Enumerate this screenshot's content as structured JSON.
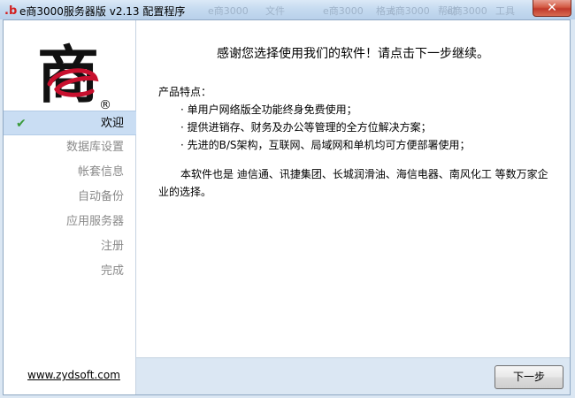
{
  "window": {
    "title": "e商3000服务器版 v2.13 配置程序",
    "close_label": "✕",
    "ghost_titles": [
      "e商3000",
      "文件",
      "e商3000",
      "格式",
      "e商3000",
      "帮助",
      "e商3000",
      "工具"
    ]
  },
  "logo": {
    "char": "商",
    "mark": "e",
    "registered": "®"
  },
  "sidebar": {
    "steps": [
      {
        "label": "欢迎",
        "active": true
      },
      {
        "label": "数据库设置",
        "active": false
      },
      {
        "label": "帐套信息",
        "active": false
      },
      {
        "label": "自动备份",
        "active": false
      },
      {
        "label": "应用服务器",
        "active": false
      },
      {
        "label": "注册",
        "active": false
      },
      {
        "label": "完成",
        "active": false
      }
    ],
    "link": "www.zydsoft.com"
  },
  "main": {
    "headline": "感谢您选择使用我们的软件！请点击下一步继续。",
    "features_title": "产品特点：",
    "features": [
      "· 单用户网络版全功能终身免费使用；",
      "· 提供进销存、财务及办公等管理的全方位解决方案；",
      "· 先进的B/S架构，互联网、局域网和单机均可方便部署使用；"
    ],
    "paragraph": "本软件也是 迪信通、讯捷集团、长城润滑油、海信电器、南风化工 等数万家企业的选择。"
  },
  "footer": {
    "next_label": "下一步"
  },
  "colors": {
    "accent": "#c9ddf3",
    "logo_red": "#c8102e",
    "check_green": "#3a9b3a"
  }
}
